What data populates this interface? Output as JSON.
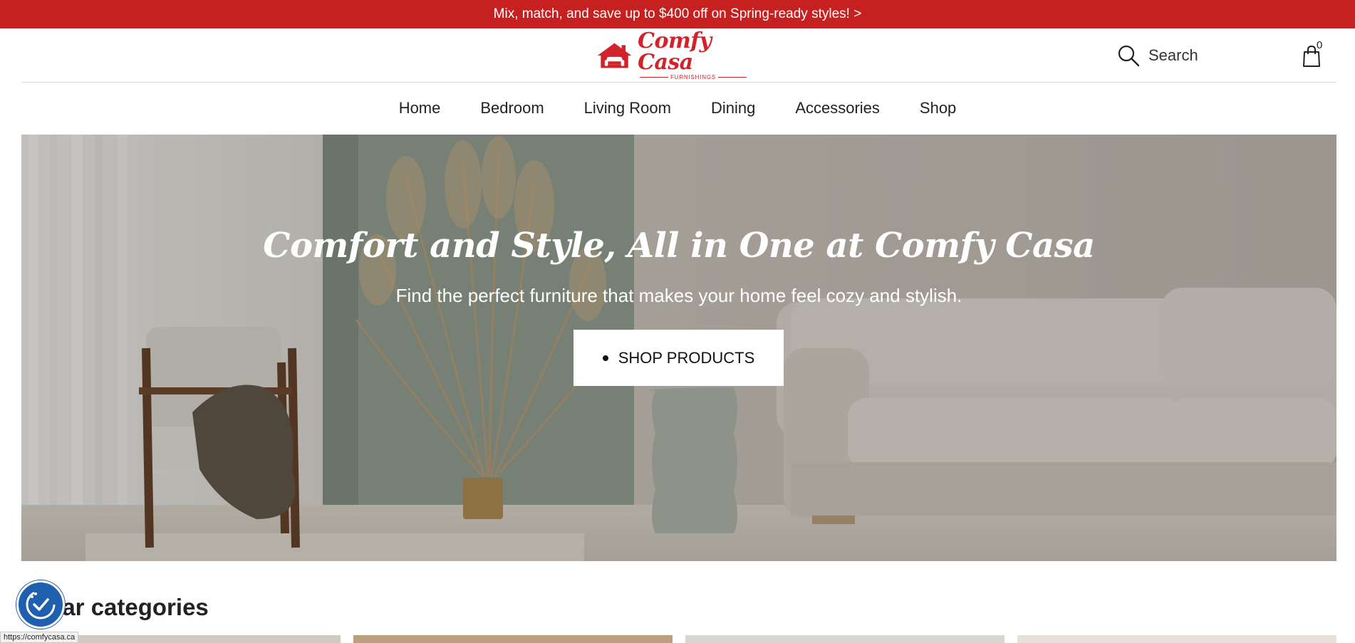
{
  "announcement": "Mix, match, and save up to $400 off on Spring-ready styles! >",
  "logo": {
    "name": "Comfy Casa",
    "sub": "FURNISHINGS"
  },
  "search": {
    "label": "Search"
  },
  "cart": {
    "count": "0"
  },
  "nav": [
    "Home",
    "Bedroom",
    "Living Room",
    "Dining",
    "Accessories",
    "Shop"
  ],
  "hero": {
    "title": "Comfort and Style, All in One at Comfy Casa",
    "subtitle": "Find the perfect furniture that makes your home feel cozy and stylish.",
    "button": "SHOP PRODUCTS"
  },
  "section": {
    "title": "ular categories"
  },
  "status_url": "https://comfycasa.ca",
  "colors": {
    "brand": "#c72020",
    "accessibility": "#1f5fb0"
  }
}
